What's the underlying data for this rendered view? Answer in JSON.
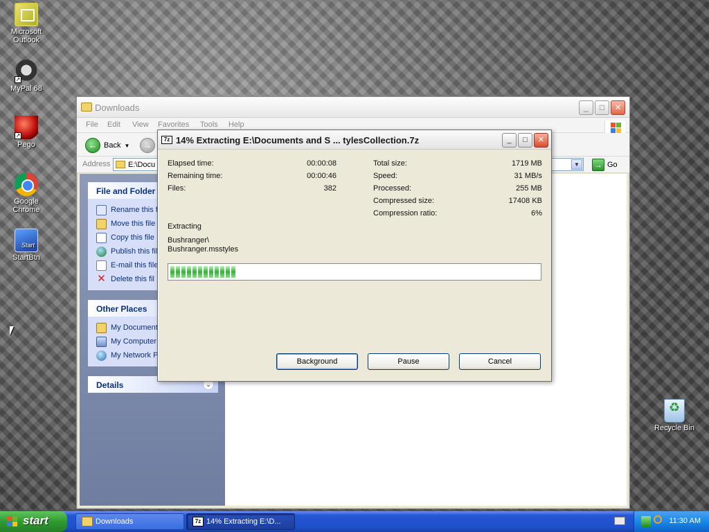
{
  "desktop": {
    "icons": [
      {
        "label": "Microsoft Outlook"
      },
      {
        "label": "MyPal 68"
      },
      {
        "label": "Pego"
      },
      {
        "label": "Google Chrome"
      },
      {
        "label": "StartBtn"
      },
      {
        "label": "Recycle Bin"
      }
    ],
    "start_icon_text": "Start"
  },
  "explorer": {
    "title": "Downloads",
    "menu": [
      "File",
      "Edit",
      "View",
      "Favorites",
      "Tools",
      "Help"
    ],
    "back_label": "Back",
    "address_label": "Address",
    "address_value": "E:\\Docu",
    "go_label": "Go",
    "file_folder_tasks": {
      "title": "File and Folder T",
      "items": [
        "Rename this f",
        "Move this file",
        "Copy this file",
        "Publish this fil",
        "E-mail this file",
        "Delete this fil"
      ]
    },
    "other_places": {
      "title": "Other Places",
      "items": [
        "My Document",
        "My Computer",
        "My Network P"
      ]
    },
    "details": {
      "title": "Details"
    }
  },
  "dialog": {
    "title": "14% Extracting E:\\Documents and S ... tylesCollection.7z",
    "icon_text": "7z",
    "elapsed_label": "Elapsed time:",
    "elapsed_value": "00:00:08",
    "remaining_label": "Remaining time:",
    "remaining_value": "00:00:46",
    "files_label": "Files:",
    "files_value": "382",
    "total_size_label": "Total size:",
    "total_size_value": "1719 MB",
    "speed_label": "Speed:",
    "speed_value": "31 MB/s",
    "processed_label": "Processed:",
    "processed_value": "255 MB",
    "compressed_label": "Compressed size:",
    "compressed_value": "17408 KB",
    "ratio_label": "Compression ratio:",
    "ratio_value": "6%",
    "status": "Extracting",
    "current_dir": "Bushranger\\",
    "current_file": "Bushranger.msstyles",
    "progress_percent": 18,
    "background_label": "Background",
    "pause_label": "Pause",
    "cancel_label": "Cancel"
  },
  "taskbar": {
    "start_label": "start",
    "tasks": [
      {
        "label": "Downloads"
      },
      {
        "label": "14% Extracting E:\\D..."
      }
    ],
    "clock": "11:30 AM"
  },
  "colors": {
    "taskbar_blue": "#2456d6",
    "start_green": "#2f9b2f",
    "progress_green": "#38b038",
    "taskpane_blue": "#6f7da0",
    "close_red": "#d84c2c"
  }
}
